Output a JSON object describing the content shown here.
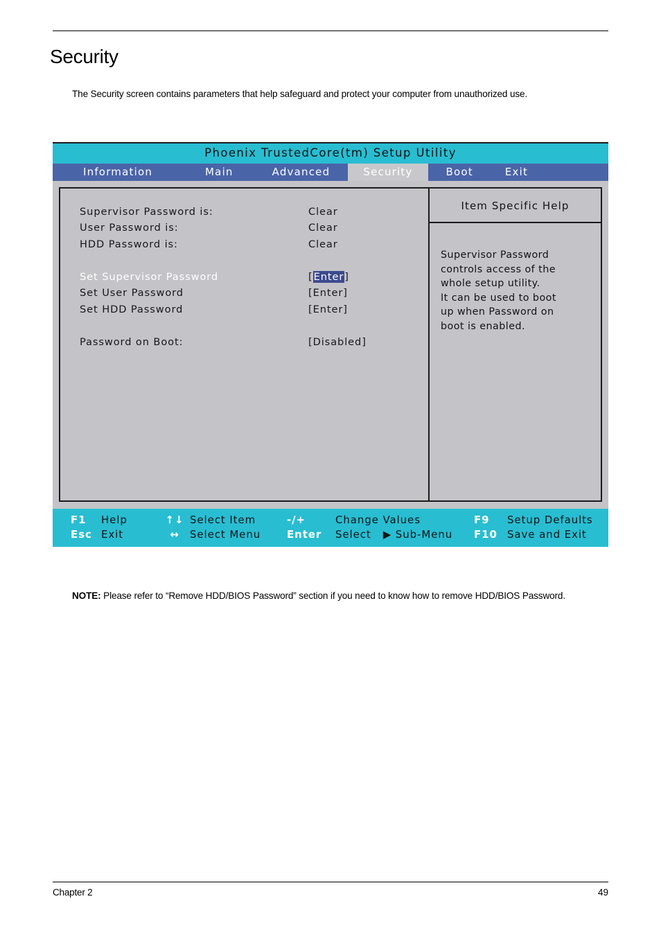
{
  "document": {
    "title": "Security",
    "intro": "The Security screen contains parameters that help safeguard and protect your computer from unauthorized use.",
    "note_label": "NOTE:",
    "note_text": " Please refer to “Remove HDD/BIOS Password” section if you need to know how to remove HDD/BIOS Password.",
    "footer_left": "Chapter 2",
    "footer_right": "49"
  },
  "bios": {
    "title": "Phoenix TrustedCore(tm) Setup Utility",
    "colors": {
      "title_bar": "#29bdd2",
      "menu_bar": "#4a64a8",
      "panel_bg": "#c3c3c8",
      "active_tab_bg": "#c8c8cc",
      "highlight": "#3c4a8e"
    },
    "menu": [
      {
        "label": "Information",
        "active": false
      },
      {
        "label": "Main",
        "active": false
      },
      {
        "label": "Advanced",
        "active": false
      },
      {
        "label": "Security",
        "active": true
      },
      {
        "label": "Boot",
        "active": false
      },
      {
        "label": "Exit",
        "active": false
      }
    ],
    "settings": [
      {
        "label": "Supervisor Password is:",
        "value": "Clear"
      },
      {
        "label": "User Password is:",
        "value": "Clear"
      },
      {
        "label": "HDD Password is:",
        "value": "Clear"
      },
      {
        "label": "Set Supervisor Password",
        "value": "[Enter]",
        "value_inner": "Enter"
      },
      {
        "label": "Set User Password",
        "value": "[Enter]"
      },
      {
        "label": "Set HDD Password",
        "value": "[Enter]"
      },
      {
        "label": "Password on Boot:",
        "value": "[Disabled]"
      }
    ],
    "help": {
      "title": "Item Specific Help",
      "text": "Supervisor Password controls access of the whole setup utility. It can be used to boot up when Password on boot is enabled.",
      "line1": "Supervisor Password",
      "line2": "controls access of the",
      "line3": "whole setup utility.",
      "line4": "It can be used to boot",
      "line5": "up when Password on",
      "line6": "boot is enabled."
    },
    "keys": {
      "row1": {
        "k1": "F1",
        "d1": "Help",
        "k2": "↑↓",
        "d2": "Select Item",
        "k3": "-/+",
        "d3": "Change Values",
        "k4": "F9",
        "d4": "Setup Defaults"
      },
      "row2": {
        "k1": "Esc",
        "d1": "Exit",
        "k2": "↔",
        "d2": "Select Menu",
        "k3": "Enter",
        "d3a": "Select",
        "d3b": "▶ Sub-Menu",
        "k4": "F10",
        "d4": "Save and Exit"
      }
    }
  }
}
